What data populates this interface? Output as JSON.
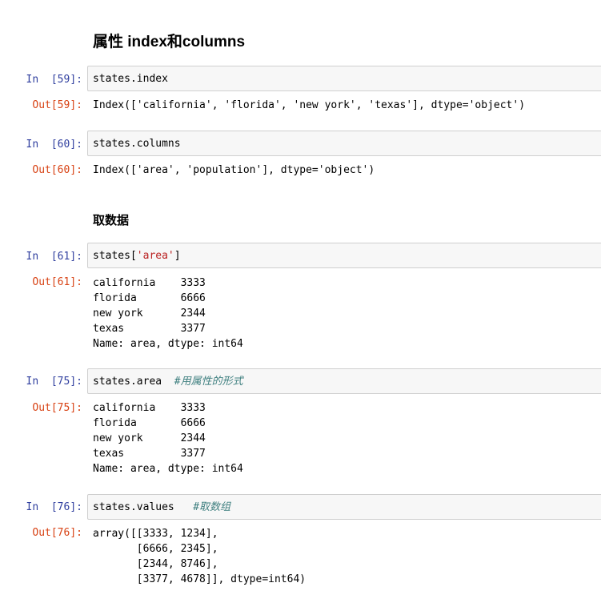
{
  "headings": {
    "attributes": "属性 index和columns",
    "get_data": "取数据"
  },
  "cells": [
    {
      "in_prompt": "In  [59]:",
      "code": "states.index",
      "out_prompt": "Out[59]:",
      "output": "Index(['california', 'florida', 'new york', 'texas'], dtype='object')"
    },
    {
      "in_prompt": "In  [60]:",
      "code": "states.columns",
      "out_prompt": "Out[60]:",
      "output": "Index(['area', 'population'], dtype='object')"
    },
    {
      "in_prompt": "In  [61]:",
      "code_prefix": "states[",
      "code_string": "'area'",
      "code_suffix": "]",
      "out_prompt": "Out[61]:",
      "output": "california    3333\nflorida       6666\nnew york      2344\ntexas         3377\nName: area, dtype: int64"
    },
    {
      "in_prompt": "In  [75]:",
      "code": "states.area  ",
      "comment": "#用属性的形式",
      "out_prompt": "Out[75]:",
      "output": "california    3333\nflorida       6666\nnew york      2344\ntexas         3377\nName: area, dtype: int64"
    },
    {
      "in_prompt": "In  [76]:",
      "code": "states.values   ",
      "comment": "#取数组",
      "out_prompt": "Out[76]:",
      "output": "array([[3333, 1234],\n       [6666, 2345],\n       [2344, 8746],\n       [3377, 4678]], dtype=int64)"
    }
  ]
}
